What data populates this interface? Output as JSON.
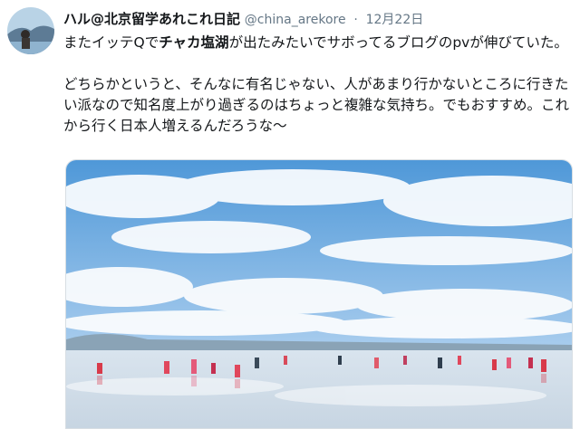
{
  "tweet": {
    "display_name": "ハル@北京留学あれこれ日記",
    "handle": "@china_arekore",
    "separator": "·",
    "date": "12月22日",
    "line1_prefix": "またイッテQで",
    "line1_bold": "チャカ塩湖",
    "line1_suffix": "が出たみたいでサボってるブログのpvが伸びていた。",
    "line2": "どちらかというと、そんなに有名じゃない、人があまり行かないところに行きたい派なので知名度上がり過ぎるのはちょっと複雑な気持ち。でもおすすめ。これから行く日本人増えるんだろうな〜"
  },
  "colors": {
    "text": "#14171a",
    "secondary": "#657786",
    "sky": "#5aa2de",
    "border": "#d7dee3"
  },
  "icons": {
    "avatar": "profile-photo",
    "photo": "salt-lake-photo"
  }
}
